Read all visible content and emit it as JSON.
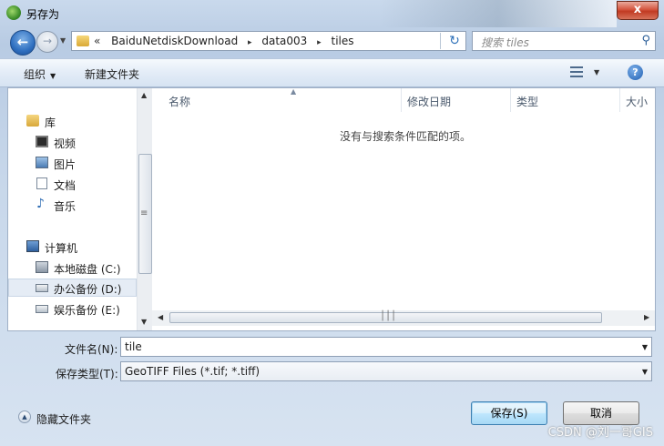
{
  "window": {
    "title": "另存为",
    "close_symbol": "x"
  },
  "address": {
    "prefix": "«",
    "crumbs": [
      "BaiduNetdiskDownload",
      "data003",
      "tiles"
    ],
    "separator": "▸"
  },
  "search": {
    "placeholder": "搜索 tiles"
  },
  "toolbar": {
    "organize": "组织",
    "new_folder": "新建文件夹"
  },
  "nav": {
    "libraries": "库",
    "videos": "视频",
    "pictures": "图片",
    "documents": "文档",
    "music": "音乐",
    "computer": "计算机",
    "local_c": "本地磁盘 (C:)",
    "office_d": "办公备份 (D:)",
    "entertain_e": "娱乐备份 (E:)"
  },
  "columns": {
    "name": "名称",
    "modified": "修改日期",
    "type": "类型",
    "size": "大小"
  },
  "empty_message": "没有与搜索条件匹配的项。",
  "form": {
    "filename_label": "文件名(N):",
    "filename_value": "tile",
    "filetype_label": "保存类型(T):",
    "filetype_value": "GeoTIFF Files (*.tif; *.tiff)"
  },
  "footer": {
    "hide_folders": "隐藏文件夹",
    "save": "保存(S)",
    "cancel": "取消"
  },
  "watermark": "CSDN @刘一哥GIS"
}
